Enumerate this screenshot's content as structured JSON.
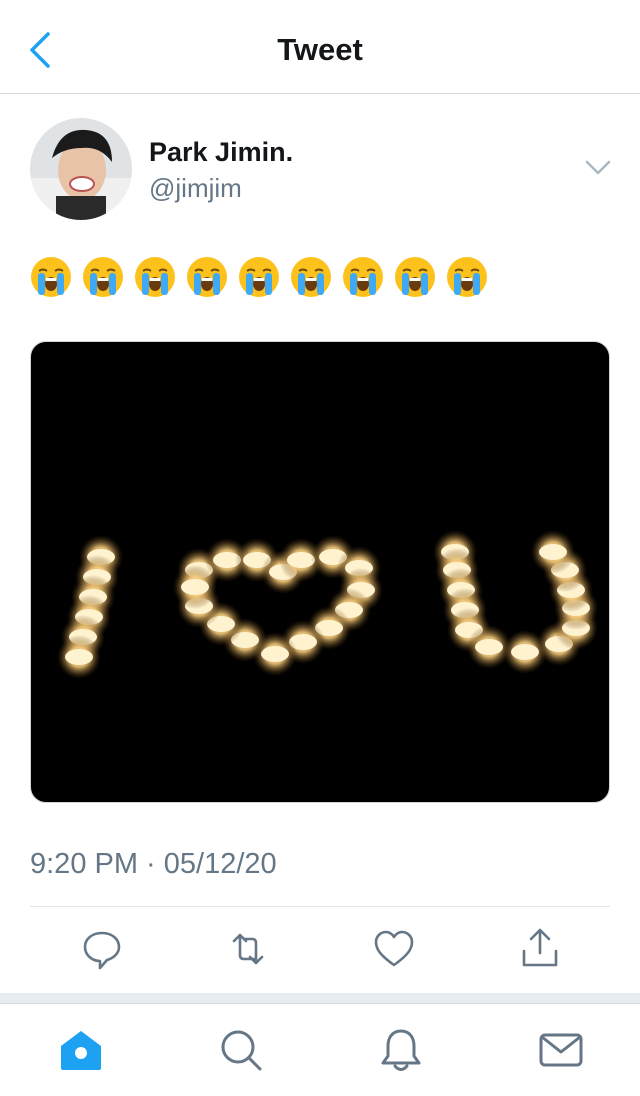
{
  "header": {
    "title": "Tweet",
    "back_icon": "chevron-left-icon"
  },
  "tweet": {
    "author_name": "Park Jimin.",
    "author_handle": "@jimjim",
    "emoji_text": "😭😭😭😭😭😭😭😭😭",
    "emoji_count": 9,
    "timestamp": "9:20 PM · 05/12/20",
    "image_description_icon": "candles-i-heart-u-photo"
  },
  "actions": [
    "reply-icon",
    "retweet-icon",
    "like-icon",
    "share-icon"
  ],
  "tabbar": [
    "home-icon",
    "search-icon",
    "notifications-icon",
    "messages-icon"
  ],
  "colors": {
    "accent": "#1da1f2",
    "secondary_text": "#657786",
    "icon_gray": "#657786"
  }
}
